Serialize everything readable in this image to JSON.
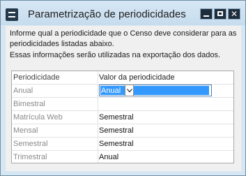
{
  "window": {
    "title": "Parametrização de periodicidades",
    "icon": "app-icon",
    "buttons": {
      "minimize": "minimize-icon",
      "maximize": "maximize-icon",
      "close": "✕"
    }
  },
  "info": {
    "line1": "Informe qual a periodicidade que o Censo deve considerar para as",
    "line2": "periodicidades listadas abaixo.",
    "line3": "Essas informações serão utilizadas na exportação dos dados."
  },
  "grid": {
    "headers": {
      "name": "Periodicidade",
      "value": "Valor da periodicidade"
    },
    "rows": [
      {
        "name": "Anual",
        "value": "Anual"
      },
      {
        "name": "Bimestral",
        "value": ""
      },
      {
        "name": "Matrícula Web",
        "value": "Semestral"
      },
      {
        "name": "Mensal",
        "value": "Semestral"
      },
      {
        "name": "Semestral",
        "value": "Semestral"
      },
      {
        "name": "Trimestral",
        "value": "Anual"
      }
    ],
    "editor": {
      "selected": "Anual"
    }
  },
  "colors": {
    "title_bar": "#c8deef",
    "selection": "#3399ff",
    "window_border": "#6f8ea6"
  }
}
